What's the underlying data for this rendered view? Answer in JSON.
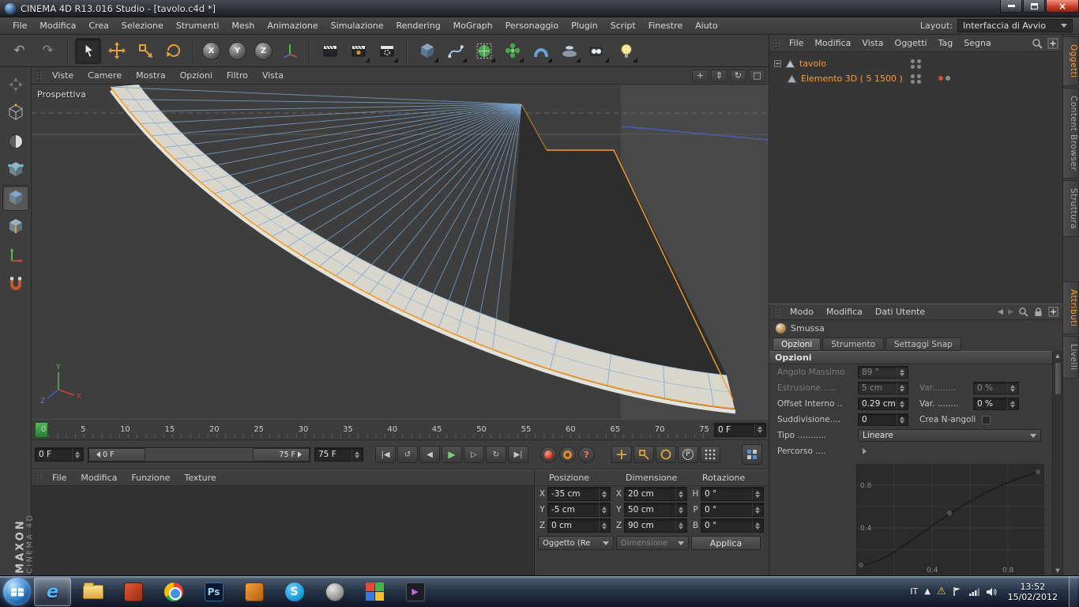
{
  "colors": {
    "accent_orange": "#f59d2c",
    "wire_blue": "#7aa4cc",
    "object_text_orange": "#ff9a2e",
    "viewport_bg": "#3e3e3e"
  },
  "titlebar": {
    "title": "CINEMA 4D R13.016 Studio - [tavolo.c4d *]"
  },
  "menubar": {
    "items": [
      "File",
      "Modifica",
      "Crea",
      "Selezione",
      "Strumenti",
      "Mesh",
      "Animazione",
      "Simulazione",
      "Rendering",
      "MoGraph",
      "Personaggio",
      "Plugin",
      "Script",
      "Finestre",
      "Aiuto"
    ],
    "layout_label": "Layout:",
    "layout_value": "Interfaccia di Avvio"
  },
  "toolbar": {
    "axis_locks": [
      "X",
      "Y",
      "Z"
    ]
  },
  "viewport": {
    "camera_label": "Prospettiva",
    "menu": [
      "Viste",
      "Camere",
      "Mostra",
      "Opzioni",
      "Filtro",
      "Vista"
    ],
    "axis": {
      "x": "X",
      "y": "Y",
      "z": "Z"
    }
  },
  "timeline": {
    "ticks": [
      "0",
      "5",
      "10",
      "15",
      "20",
      "25",
      "30",
      "35",
      "40",
      "45",
      "50",
      "55",
      "60",
      "65",
      "70",
      "75"
    ],
    "ruler_frame": "0 F",
    "current_frame": "0 F",
    "slider_start": "0 F",
    "slider_end": "75 F",
    "end_frame": "75 F",
    "p_label": "P",
    "help_label": "?"
  },
  "materials": {
    "menu": [
      "File",
      "Modifica",
      "Funzione",
      "Texture"
    ],
    "brand_main": "MAXON",
    "brand_sub": "CINEMA 4D"
  },
  "coordinates": {
    "col_titles": [
      "Posizione",
      "Dimensione",
      "Rotazione"
    ],
    "rows": [
      {
        "pl": "X",
        "pv": "-35 cm",
        "dl": "X",
        "dv": "20 cm",
        "rl": "H",
        "rv": "0 °"
      },
      {
        "pl": "Y",
        "pv": "-5 cm",
        "dl": "Y",
        "dv": "50 cm",
        "rl": "P",
        "rv": "0 °"
      },
      {
        "pl": "Z",
        "pv": "0 cm",
        "dl": "Z",
        "dv": "90 cm",
        "rl": "B",
        "rv": "0 °"
      }
    ],
    "object_mode": "Oggetto (Re",
    "dim_mode": "Dimensione",
    "apply": "Applica"
  },
  "object_manager": {
    "menu": [
      "File",
      "Modifica",
      "Vista",
      "Oggetti",
      "Tag",
      "Segna"
    ],
    "root_object": "tavolo",
    "child_object": "Elemento 3D ( 5 1500 )"
  },
  "attributes": {
    "menu": [
      "Modo",
      "Modifica",
      "Dati Utente"
    ],
    "tool": "Smussa",
    "tabs": [
      "Opzioni",
      "Strumento",
      "Settaggi Snap"
    ],
    "section": "Opzioni",
    "angolo_label": "Angolo Massimo",
    "angolo_value": "89 °",
    "estrusione_label": "Estrusione......",
    "estrusione_value": "5 cm",
    "var1_label": "Var.........",
    "var1_value": "0 %",
    "offset_label": "Offset Interno ..",
    "offset_value": "0.29 cm",
    "var2_label": "Var. ........",
    "var2_value": "0 %",
    "suddiv_label": "Suddivisione....",
    "suddiv_value": "0",
    "nangoli_label": "Crea N-angoli",
    "tipo_label": "Tipo ...........",
    "tipo_value": "Lineare",
    "percorso_label": "Percorso ....",
    "graph_y_ticks": [
      "0.8",
      "0.4"
    ],
    "graph_x_ticks": [
      "0.4",
      "0.8"
    ]
  },
  "side_tabs": {
    "top": [
      "Oggetti",
      "Content Browser",
      "Struttura"
    ],
    "bottom": [
      "Attributi",
      "Livelli"
    ]
  },
  "taskbar": {
    "lang": "IT",
    "time": "13:52",
    "date": "15/02/2012",
    "ie_label": "e",
    "ps_label": "Ps",
    "skype_label": "S"
  }
}
